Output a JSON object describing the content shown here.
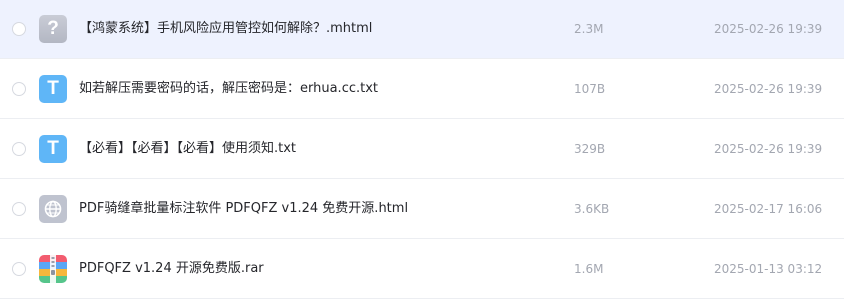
{
  "files": [
    {
      "name": "【鸿蒙系统】手机风险应用管控如何解除？.mhtml",
      "size": "2.3M",
      "date": "2025-02-26 19:39",
      "icon": "unknown-file-icon",
      "icon_glyph": "?",
      "selected": true
    },
    {
      "name": "如若解压需要密码的话，解压密码是：erhua.cc.txt",
      "size": "107B",
      "date": "2025-02-26 19:39",
      "icon": "text-file-icon",
      "icon_glyph": "T",
      "selected": false
    },
    {
      "name": "【必看】【必看】【必看】使用须知.txt",
      "size": "329B",
      "date": "2025-02-26 19:39",
      "icon": "text-file-icon",
      "icon_glyph": "T",
      "selected": false
    },
    {
      "name": "PDF骑缝章批量标注软件 PDFQFZ v1.24 免费开源.html",
      "size": "3.6KB",
      "date": "2025-02-17 16:06",
      "icon": "web-file-icon",
      "selected": false
    },
    {
      "name": "PDFQFZ v1.24 开源免费版.rar",
      "size": "1.6M",
      "date": "2025-01-13 03:12",
      "icon": "archive-file-icon",
      "selected": false
    }
  ],
  "colors": {
    "selected_row": "#eef2fe",
    "text_file_icon": "#5fb6f7",
    "unknown_file_icon": "#c0c3ce",
    "meta_text": "#a3a7b1",
    "name_text": "#25262b"
  }
}
